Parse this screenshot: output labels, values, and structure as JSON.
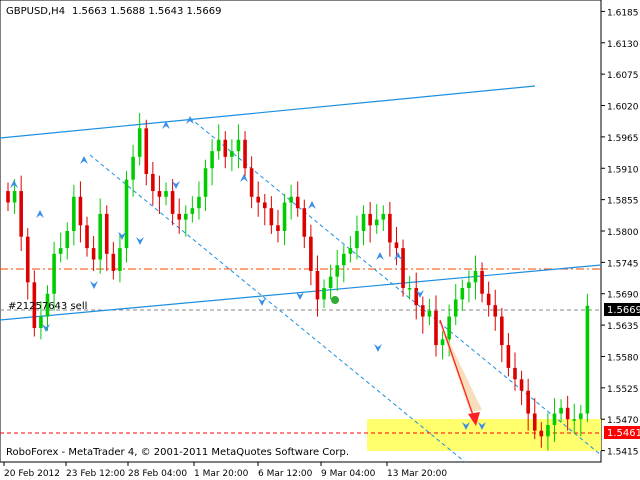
{
  "header": {
    "symbol_title": "GBPUSD,H4",
    "ohlc": "1.5663 1.5688 1.5643 1.5669"
  },
  "footer": {
    "copyright": "RoboForex - MetaTrader 4, © 2001-2011 MetaQuotes Software Corp."
  },
  "order_label": "#21257643 sell",
  "colors": {
    "bull": "#00cc00",
    "bear": "#dd0000",
    "channel_line": "#1e8fe0",
    "level_line": "#ff4400",
    "highlight_zone": "#ffff66",
    "arrow": "#ff2222",
    "fractal": "#3a8ee6"
  },
  "chart_data": {
    "type": "candlestick",
    "price_axis_ticks": [
      "1.6185",
      "1.6130",
      "1.6075",
      "1.6020",
      "1.5965",
      "1.5910",
      "1.5855",
      "1.5800",
      "1.5745",
      "1.5690",
      "1.5635",
      "1.5580",
      "1.5525",
      "1.5470",
      "1.5415"
    ],
    "time_axis_ticks": [
      "20 Feb 2012",
      "23 Feb 12:00",
      "28 Feb 04:00",
      "1 Mar 20:00",
      "6 Mar 12:00",
      "9 Mar 04:00",
      "13 Mar 20:00"
    ],
    "ylim": [
      1.5395,
      1.6205
    ],
    "current_price": "1.5669",
    "target_level": "1.5461",
    "resistance_level": 1.5742,
    "sell_order_level": 1.5671,
    "target_zone": [
      1.5435,
      1.5489
    ],
    "closes": [
      1.585,
      1.587,
      1.579,
      1.571,
      1.563,
      1.565,
      1.569,
      1.576,
      1.577,
      1.58,
      1.586,
      1.581,
      1.577,
      1.575,
      1.583,
      1.576,
      1.573,
      1.577,
      1.589,
      1.593,
      1.598,
      1.59,
      1.587,
      1.586,
      1.587,
      1.583,
      1.582,
      1.583,
      1.584,
      1.586,
      1.591,
      1.594,
      1.596,
      1.593,
      1.594,
      1.596,
      1.591,
      1.586,
      1.585,
      1.584,
      1.581,
      1.58,
      1.585,
      1.586,
      1.584,
      1.579,
      1.573,
      1.568,
      1.57,
      1.572,
      1.574,
      1.576,
      1.577,
      1.58,
      1.583,
      1.581,
      1.582,
      1.583,
      1.578,
      1.577,
      1.57,
      1.57,
      1.567,
      1.565,
      1.566,
      1.56,
      1.561,
      1.565,
      1.568,
      1.57,
      1.571,
      1.573,
      1.569,
      1.567,
      1.565,
      1.56,
      1.556,
      1.554,
      1.552,
      1.548,
      1.545,
      1.544,
      1.546,
      1.548,
      1.549,
      1.547,
      1.547,
      1.548,
      1.5669
    ],
    "channel_lines": [
      {
        "style": "solid",
        "points": [
          [
            1.5965,
            0
          ],
          [
            1.6045,
            1
          ]
        ]
      },
      {
        "style": "solid",
        "points": [
          [
            1.5635,
            0
          ],
          [
            1.5745,
            1
          ]
        ]
      },
      {
        "style": "dashed",
        "points": [
          [
            1.5905,
            0
          ],
          [
            1.5415,
            1
          ]
        ]
      },
      {
        "style": "dashed",
        "points": [
          [
            1.599,
            0
          ],
          [
            1.5475,
            1
          ]
        ]
      }
    ]
  }
}
